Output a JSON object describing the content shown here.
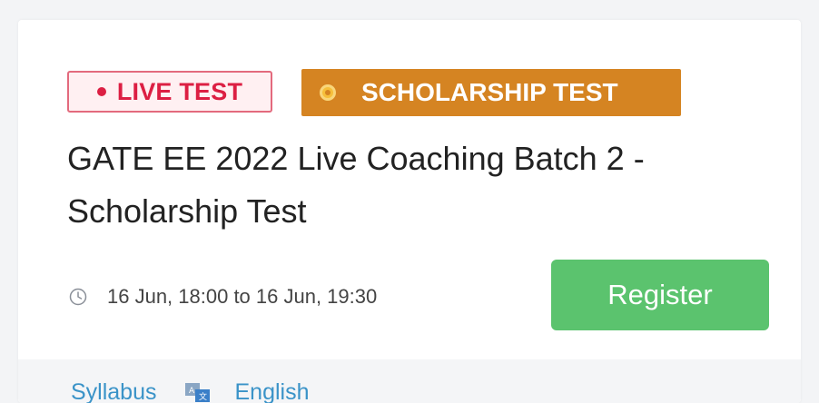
{
  "badges": {
    "live": "LIVE TEST",
    "scholarship": "SCHOLARSHIP TEST"
  },
  "title": "GATE EE 2022 Live Coaching Batch 2 - Scholarship Test",
  "timing": "16 Jun, 18:00 to 16 Jun, 19:30",
  "register_label": "Register",
  "footer": {
    "syllabus": "Syllabus",
    "language": "English"
  },
  "icons": {
    "live": "live-dot-icon",
    "scholarship": "coin-icon",
    "timing": "clock-icon",
    "language": "language-icon"
  },
  "colors": {
    "live_text": "#dc1f43",
    "scholarship_bg": "#d58422",
    "register_bg": "#5bc36e",
    "link": "#3a93c8"
  }
}
